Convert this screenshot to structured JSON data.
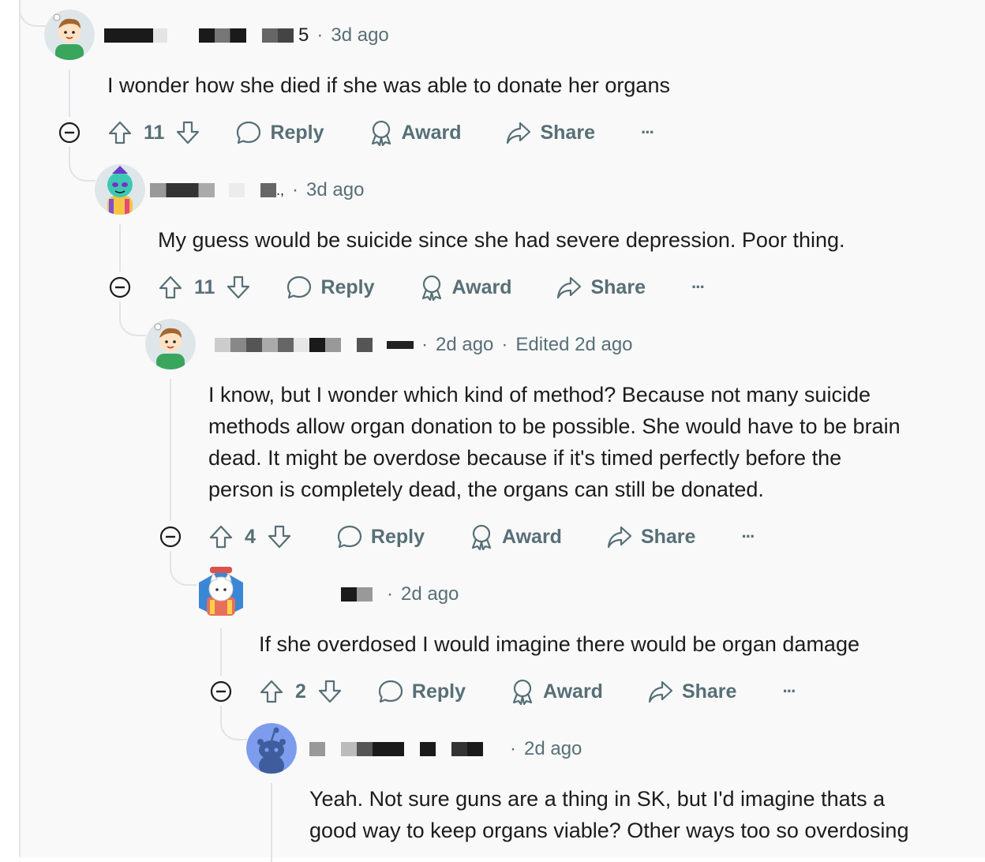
{
  "comments": [
    {
      "user_fragment": "5",
      "time": "3d ago",
      "edited": "",
      "text": "I wonder how she died if she was able to donate her organs",
      "votes": "11",
      "reply_label": "Reply",
      "award_label": "Award",
      "share_label": "Share",
      "more_label": "···"
    },
    {
      "user_fragment": ".,",
      "time": "3d ago",
      "edited": "",
      "text": "My guess would be suicide since she had severe depression. Poor thing.",
      "votes": "11",
      "reply_label": "Reply",
      "award_label": "Award",
      "share_label": "Share",
      "more_label": "···"
    },
    {
      "user_fragment": "",
      "time": "2d ago",
      "edited": "Edited 2d ago",
      "text_lines": [
        "I know, but I wonder which kind of method? Because not many suicide",
        "methods allow organ donation to be possible. She would have to be brain",
        "dead. It might be overdose because if it's timed perfectly before the",
        "person is completely dead, the organs can still be donated."
      ],
      "votes": "4",
      "reply_label": "Reply",
      "award_label": "Award",
      "share_label": "Share",
      "more_label": "···"
    },
    {
      "user_fragment": "",
      "time": "2d ago",
      "edited": "",
      "text": "If she overdosed I would imagine there would be organ damage",
      "votes": "2",
      "reply_label": "Reply",
      "award_label": "Award",
      "share_label": "Share",
      "more_label": "···"
    },
    {
      "user_fragment": "",
      "time": "2d ago",
      "edited": "",
      "text_lines": [
        "Yeah. Not sure guns are a thing in SK, but I'd imagine thats a",
        "good way to keep organs viable? Other ways too so overdosing"
      ]
    }
  ],
  "icons": {
    "upvote": "upvote-arrow-icon",
    "downvote": "downvote-arrow-icon",
    "reply": "speech-bubble-icon",
    "award": "award-ribbon-icon",
    "share": "share-arrow-icon",
    "collapse": "minus-circle-icon"
  },
  "colors": {
    "meta_text": "#576f76",
    "thread_line": "#e1e3e6",
    "body_text": "#1c1c1c"
  }
}
